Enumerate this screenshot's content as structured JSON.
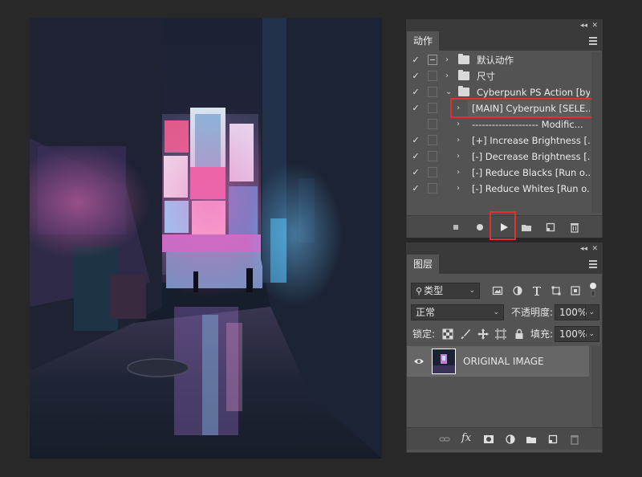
{
  "actions_panel": {
    "tab_label": "动作",
    "collapse_glyph": "◂◂",
    "close_glyph": "✕",
    "rows": [
      {
        "check": "✓",
        "arrow": "›",
        "folder": true,
        "label": "默认动作",
        "indent": 0,
        "dialog": true
      },
      {
        "check": "✓",
        "arrow": "›",
        "folder": true,
        "label": "尺寸",
        "indent": 0,
        "dialog": false
      },
      {
        "check": "✓",
        "arrow": "⌄",
        "folder": true,
        "label": "Cyberpunk PS Action [by ...",
        "indent": 0,
        "dialog": false
      },
      {
        "check": "✓",
        "arrow": "›",
        "folder": false,
        "label": "[MAIN] Cyberpunk [SELE...",
        "indent": 1,
        "dialog": false,
        "highlighted": true
      },
      {
        "check": "",
        "arrow": "›",
        "folder": false,
        "label": "-------------------- Modific...",
        "indent": 1,
        "dialog": false
      },
      {
        "check": "✓",
        "arrow": "›",
        "folder": false,
        "label": "[+] Increase Brightness [...",
        "indent": 1,
        "dialog": false
      },
      {
        "check": "✓",
        "arrow": "›",
        "folder": false,
        "label": "[-] Decrease Brightness [...",
        "indent": 1,
        "dialog": false
      },
      {
        "check": "✓",
        "arrow": "›",
        "folder": false,
        "label": "[-] Reduce Blacks [Run o...",
        "indent": 1,
        "dialog": false
      },
      {
        "check": "✓",
        "arrow": "›",
        "folder": false,
        "label": "[-] Reduce Whites [Run o...",
        "indent": 1,
        "dialog": false
      }
    ],
    "footer_icons": [
      "stop-icon",
      "record-icon",
      "play-icon",
      "new-set-icon",
      "new-action-icon",
      "delete-icon"
    ]
  },
  "layers_panel": {
    "tab_label": "图层",
    "collapse_glyph": "◂◂",
    "close_glyph": "✕",
    "filter_kind": "类型",
    "blend_mode": "正常",
    "opacity_label": "不透明度:",
    "opacity_value": "100%",
    "lock_label": "锁定:",
    "fill_label": "填充:",
    "fill_value": "100%",
    "layers": [
      {
        "name": "ORIGINAL IMAGE",
        "visible": true
      }
    ],
    "footer_icons": [
      "link-icon",
      "fx-icon",
      "mask-icon",
      "adjustment-icon",
      "group-icon",
      "new-layer-icon",
      "delete-icon"
    ]
  },
  "colors": {
    "highlight_red": "#e03030",
    "panel_bg": "#535353",
    "app_bg": "#282828"
  }
}
